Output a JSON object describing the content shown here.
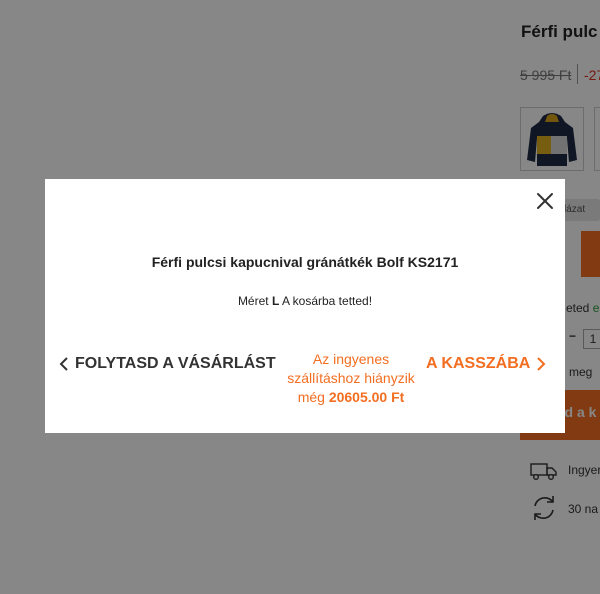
{
  "background_page": {
    "product_title": "Férfi pulc",
    "price_old": "5 995 Ft",
    "price_discount": "-27",
    "chip_label": "lázat",
    "availability_prefix": "eted",
    "availability_suffix": "e",
    "quantity_minus": "−",
    "quantity_value": "1",
    "notify_text": "l meg",
    "add_to_cart_label": "dd a k",
    "feature_shipping": "Ingyer",
    "feature_return": "30 na"
  },
  "modal": {
    "title": "Férfi pulcsi kapucnival gránátkék Bolf KS2171",
    "added_prefix": "Méret",
    "added_size": "L",
    "added_suffix": "A kosárba tetted!",
    "continue_label": "FOLYTASD A VÁSÁRLÁST",
    "shipping_line1": "Az ingyenes",
    "shipping_line2": "szállításhoz hiányzik",
    "shipping_prefix": "még",
    "shipping_amount": "20605.00 Ft",
    "checkout_label": "A KASSZÁBA"
  },
  "colors": {
    "accent": "#f36e21",
    "overlay": "rgba(0,0,0,0.47)",
    "discount": "#e0301e"
  },
  "icons": {
    "close": "close-icon",
    "continue": "chevron-left-icon",
    "checkout": "chevron-right-icon",
    "truck": "truck-icon",
    "return": "return-arrows-icon"
  }
}
